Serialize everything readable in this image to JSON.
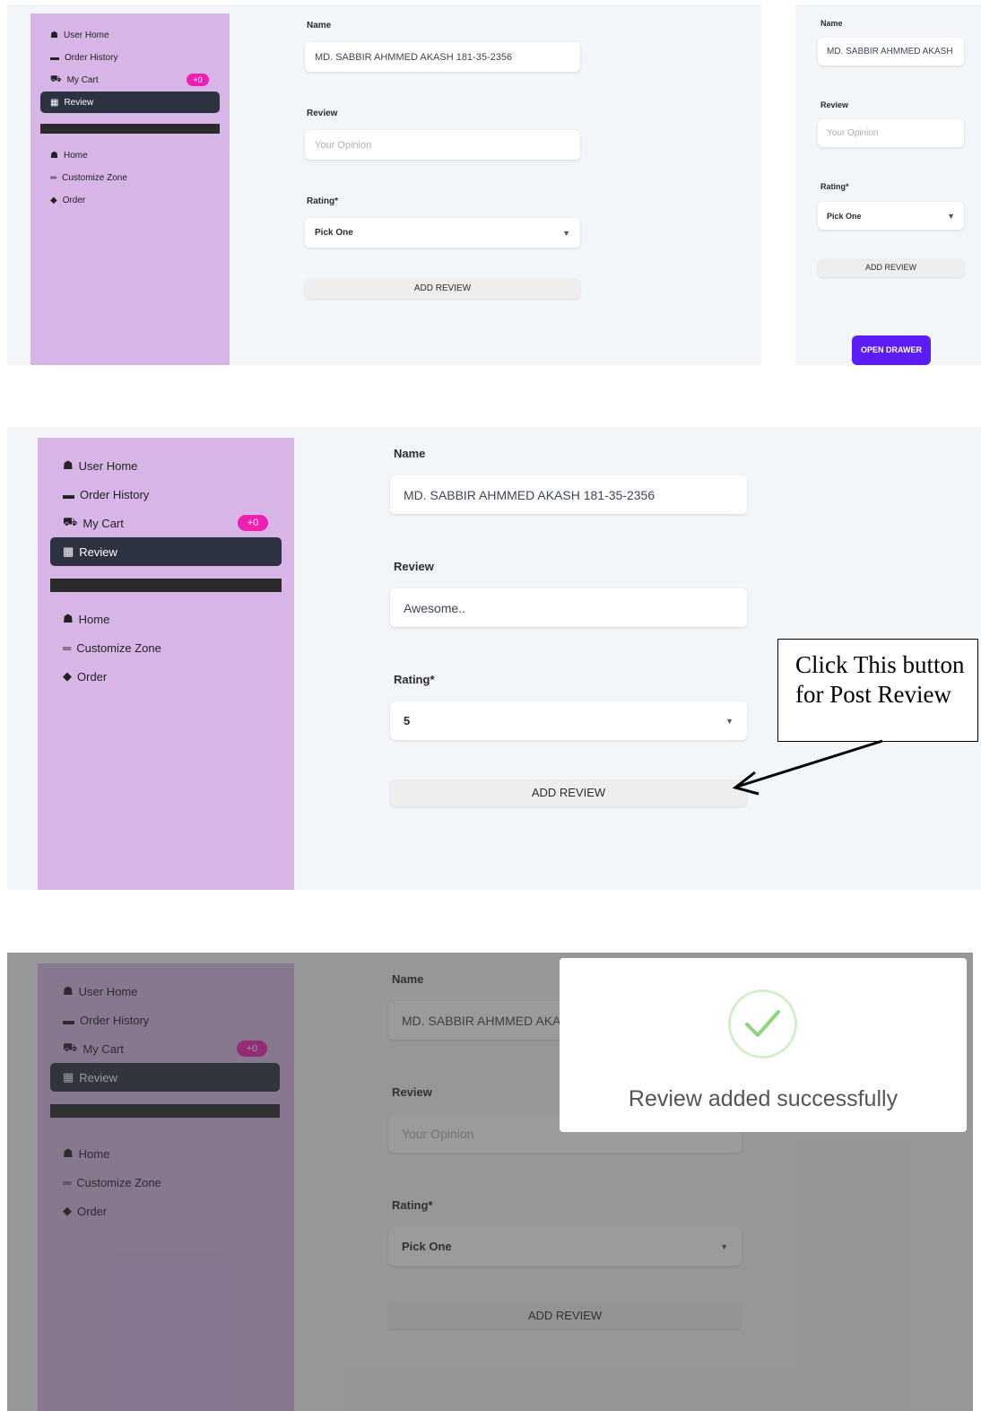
{
  "sidebar": {
    "items": [
      {
        "icon": "home-icon",
        "label": "User Home"
      },
      {
        "icon": "wallet-icon",
        "label": "Order History"
      },
      {
        "icon": "cart-icon",
        "label": "My Cart",
        "badge": "+0"
      },
      {
        "icon": "calendar-icon",
        "label": "Review"
      },
      {
        "icon": "home-icon",
        "label": "Home"
      },
      {
        "icon": "bars-icon",
        "label": "Customize Zone"
      },
      {
        "icon": "bag-icon",
        "label": "Order"
      }
    ]
  },
  "form": {
    "name_label": "Name",
    "name_value": "MD. SABBIR AHMMED AKASH 181-35-2356",
    "name_value_clipped": "MD. SABBIR AHMMED AKA",
    "name_value_mobile": "MD. SABBIR AHMMED AKASH",
    "review_label": "Review",
    "review_placeholder": "Your Opinion",
    "review_value_filled": "Awesome..",
    "rating_label": "Rating*",
    "rating_default": "Pick One",
    "rating_selected": "5",
    "add_button": "ADD REVIEW"
  },
  "mobile": {
    "open_drawer": "OPEN DRAWER"
  },
  "annotation": {
    "text": "Click This button for Post Review"
  },
  "modal": {
    "message": "Review added successfully",
    "icon": "checkmark-icon"
  },
  "colors": {
    "sidebar": "#d7b6e7",
    "active_item": "#2d3240",
    "badge": "#ef1fb2",
    "drawer_button": "#5b1cf5",
    "success_check": "#8fd47a"
  }
}
